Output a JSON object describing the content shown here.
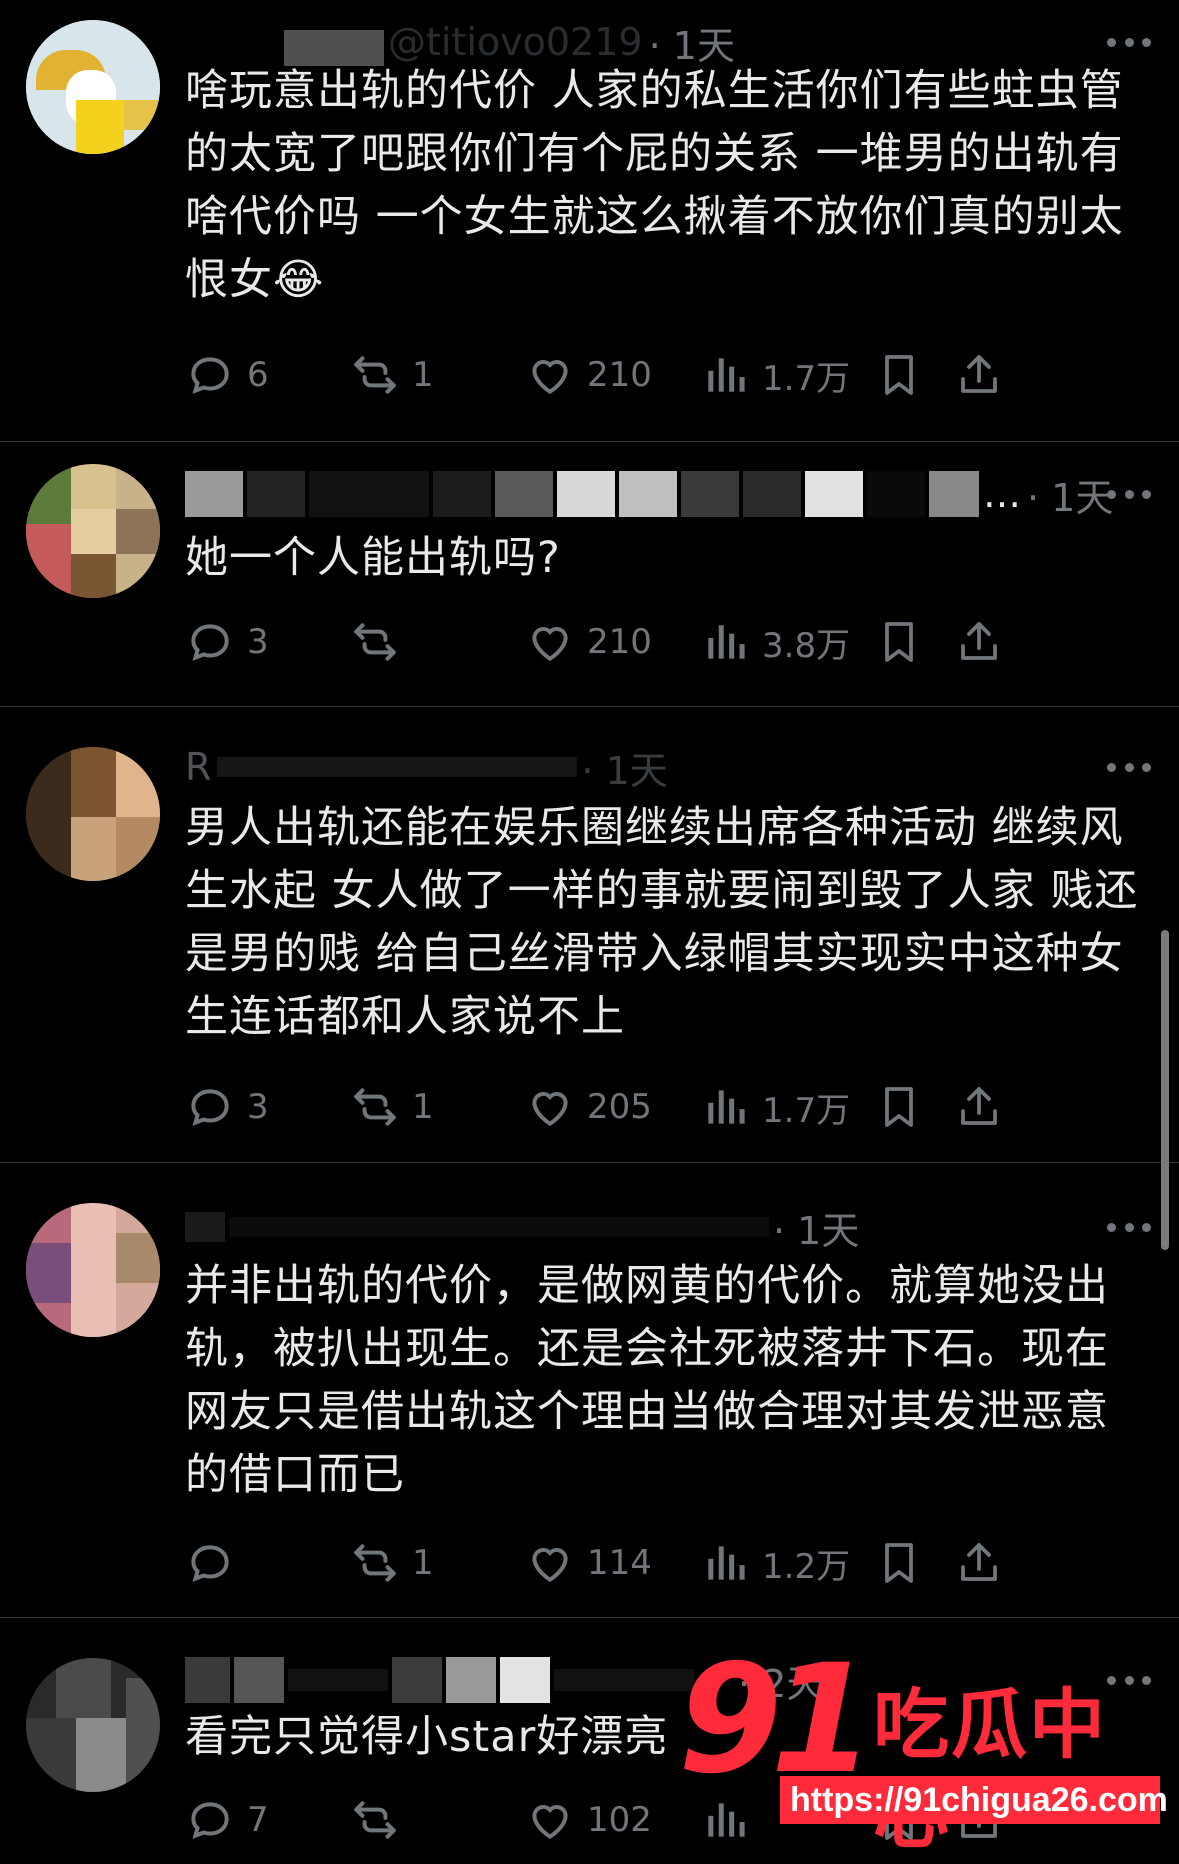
{
  "posts": [
    {
      "handle_fragment": "@titiovo0219",
      "time": "· 1天",
      "text": "啥玩意出轨的代价 人家的私生活你们有些蛀虫管的太宽了吧跟你们有个屁的关系 一堆男的出轨有啥代价吗 一个女生就这么揪着不放你们真的别太恨女😂",
      "replies": "6",
      "reposts": "1",
      "likes": "210",
      "views": "1.7万"
    },
    {
      "handle_fragment": "…",
      "time": "· 1天",
      "text": "她一个人能出轨吗?",
      "replies": "3",
      "reposts": "",
      "likes": "210",
      "views": "3.8万"
    },
    {
      "handle_fragment": "R",
      "time": "· 1天",
      "text": "男人出轨还能在娱乐圈继续出席各种活动 继续风生水起 女人做了一样的事就要闹到毁了人家 贱还是男的贱 给自己丝滑带入绿帽其实现实中这种女生连话都和人家说不上",
      "replies": "3",
      "reposts": "1",
      "likes": "205",
      "views": "1.7万"
    },
    {
      "handle_fragment": "",
      "time": "· 1天",
      "text": "并非出轨的代价，是做网黄的代价。就算她没出轨，被扒出现生。还是会社死被落井下石。现在网友只是借出轨这个理由当做合理对其发泄恶意的借口而已",
      "replies": "",
      "reposts": "1",
      "likes": "114",
      "views": "1.2万"
    },
    {
      "handle_fragment": "",
      "time": "· 2天",
      "text": "看完只觉得小star好漂亮",
      "replies": "7",
      "reposts": "",
      "likes": "102",
      "views": ""
    }
  ],
  "watermark": {
    "brand_number": "91",
    "brand_name": "吃瓜中心",
    "url": "https://91chigua26.com"
  },
  "colors": {
    "background": "#000000",
    "text": "#e7e9ea",
    "muted": "#71767b",
    "divider": "#2f3336",
    "watermark": "#ff2b3a"
  },
  "icons": [
    "reply-icon",
    "repost-icon",
    "like-icon",
    "views-icon",
    "bookmark-icon",
    "share-icon",
    "more-icon"
  ]
}
